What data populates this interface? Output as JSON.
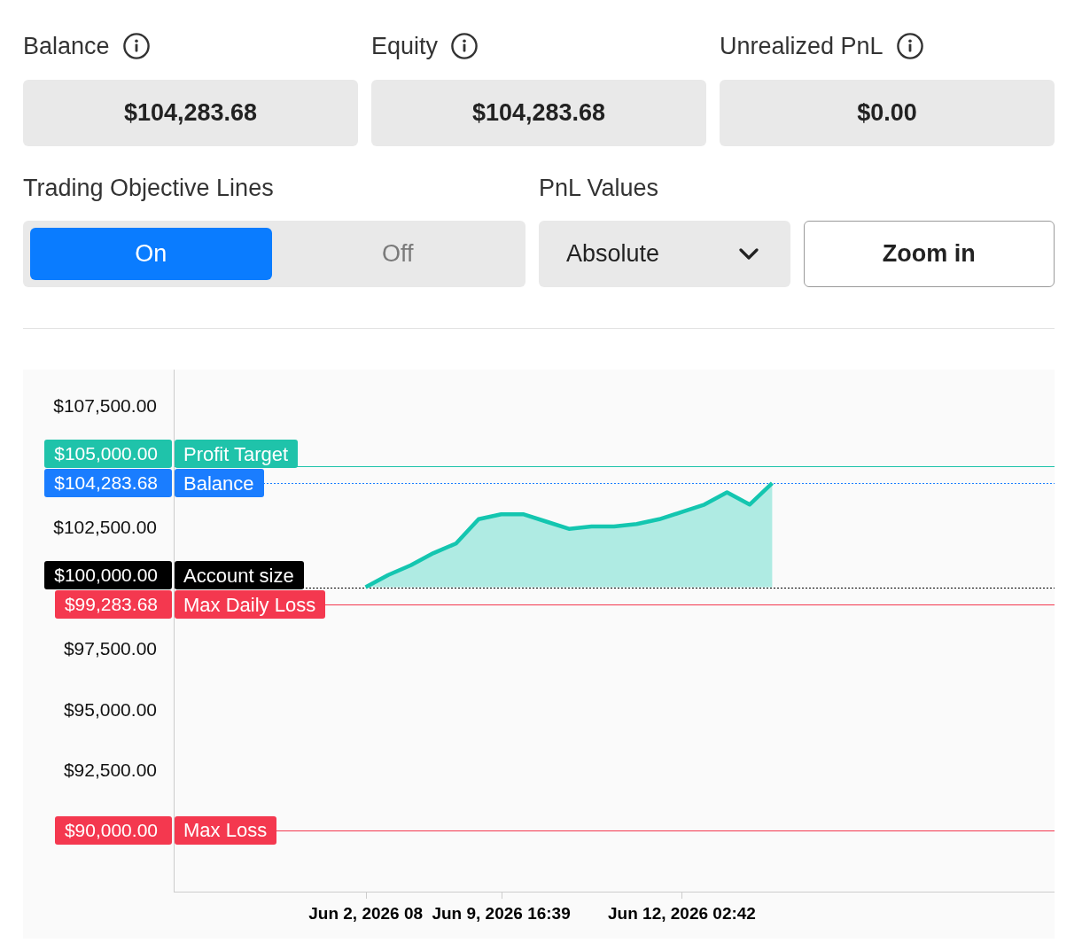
{
  "stats": [
    {
      "label": "Balance",
      "value": "$104,283.68"
    },
    {
      "label": "Equity",
      "value": "$104,283.68"
    },
    {
      "label": "Unrealized PnL",
      "value": "$0.00"
    }
  ],
  "objective_lines": {
    "label": "Trading Objective Lines",
    "options": [
      {
        "label": "On",
        "selected": true
      },
      {
        "label": "Off",
        "selected": false
      }
    ]
  },
  "pnl_values": {
    "label": "PnL Values",
    "value": "Absolute"
  },
  "zoom_button": {
    "label": "Zoom in"
  },
  "chart": {
    "chart_data": {
      "type": "area",
      "categories": [
        null,
        null,
        null,
        null,
        null,
        null,
        null,
        null,
        "Jun 2, 2026 08",
        null,
        null,
        null,
        null,
        null,
        "Jun 9, 2026 16:39",
        null,
        null,
        null,
        null,
        null,
        null,
        null,
        "Jun 12, 2026 02:42",
        null,
        null,
        null,
        null,
        null,
        null,
        null,
        null,
        null,
        null,
        null,
        null,
        null,
        null,
        null,
        null
      ],
      "values": [
        null,
        null,
        null,
        null,
        null,
        null,
        null,
        null,
        100000,
        100500,
        100900,
        101400,
        101800,
        102800,
        103000,
        103000,
        102700,
        102400,
        102500,
        102500,
        102600,
        102800,
        103100,
        103400,
        103900,
        103400,
        104283.68,
        null,
        null,
        null,
        null,
        null,
        null,
        null,
        null,
        null,
        null,
        null,
        null
      ],
      "ylim": [
        87464,
        108960
      ],
      "yticks": [
        {
          "value": 107500,
          "label": "$107,500.00"
        },
        {
          "value": 102500,
          "label": "$102,500.00"
        },
        {
          "value": 97500,
          "label": "$97,500.00"
        },
        {
          "value": 95000,
          "label": "$95,000.00"
        },
        {
          "value": 92500,
          "label": "$92,500.00"
        }
      ],
      "ref_lines": [
        {
          "axis": "y",
          "value": 105000,
          "label": "Profit Target",
          "color": "#1fc3aa"
        },
        {
          "axis": "y",
          "value": 104283.68,
          "label": "Balance",
          "color": "#1a7dff"
        },
        {
          "axis": "y",
          "value": 100000,
          "label": "Account size",
          "color": "#000000"
        },
        {
          "axis": "y",
          "value": 99283.68,
          "label": "Max Daily Loss",
          "color": "#f4384f"
        },
        {
          "axis": "y",
          "value": 90000,
          "label": "Max Loss",
          "color": "#f4384f"
        }
      ],
      "annotations": [
        "$105,000.00",
        "$104,283.68",
        "$100,000.00",
        "$99,283.68",
        "$90,000.00"
      ]
    }
  }
}
